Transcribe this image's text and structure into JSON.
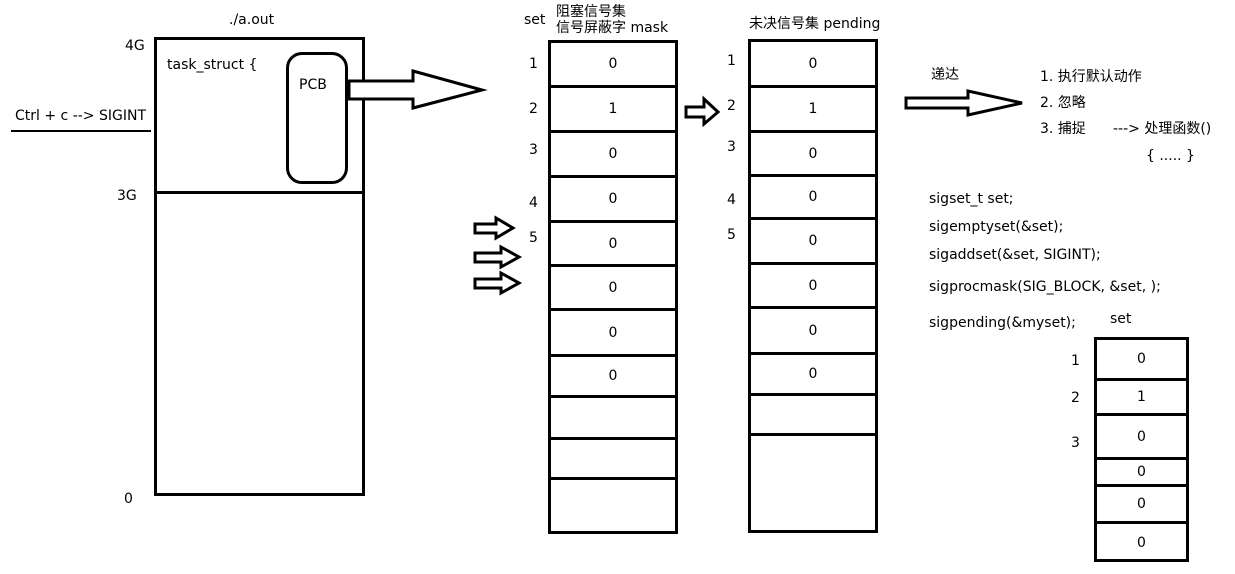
{
  "process": {
    "title": "./a.out",
    "addr_4g": "4G",
    "addr_3g": "3G",
    "addr_0": "0",
    "task_struct": "task_struct {",
    "pcb": "PCB"
  },
  "signal_source": "Ctrl + c --> SIGINT",
  "mask": {
    "set_label": "set",
    "title_line1": "阻塞信号集",
    "title_line2": "信号屏蔽字 mask",
    "indices": [
      "1",
      "2",
      "3",
      "4",
      "5"
    ],
    "values": [
      "0",
      "1",
      "0",
      "0",
      "0",
      "0",
      "0",
      "0",
      "",
      "",
      ""
    ]
  },
  "pending": {
    "title": "未决信号集 pending",
    "indices": [
      "1",
      "2",
      "3",
      "4",
      "5"
    ],
    "values": [
      "0",
      "1",
      "0",
      "0",
      "0",
      "0",
      "0",
      "0",
      "",
      ""
    ]
  },
  "delivery": {
    "label": "递达",
    "options": [
      "1. 执行默认动作",
      "2. 忽略",
      "3. 捕捉"
    ],
    "handler": "---> 处理函数()",
    "handler_body": "{  ..... }"
  },
  "code": [
    "sigset_t set;",
    "sigemptyset(&set);",
    " sigaddset(&set, SIGINT);",
    "sigprocmask(SIG_BLOCK, &set, );",
    " sigpending(&myset);"
  ],
  "myset": {
    "label": "set",
    "indices": [
      "1",
      "2",
      "3"
    ],
    "values": [
      "0",
      "1",
      "0",
      "0",
      "0",
      "0"
    ]
  }
}
